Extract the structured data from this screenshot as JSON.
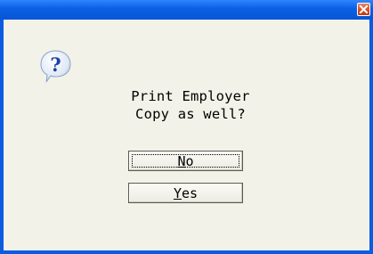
{
  "dialog": {
    "close_icon": "close-x-icon",
    "close_color": "#d24b20",
    "titlebar_color": "#0b5ce0",
    "message_icon": "question-mark-icon",
    "message_lines": [
      "Print Employer",
      "Copy as well?"
    ],
    "buttons": {
      "no": {
        "mnemonic": "N",
        "rest": "o",
        "focused": true
      },
      "yes": {
        "mnemonic": "Y",
        "rest": "es",
        "focused": false
      }
    }
  }
}
